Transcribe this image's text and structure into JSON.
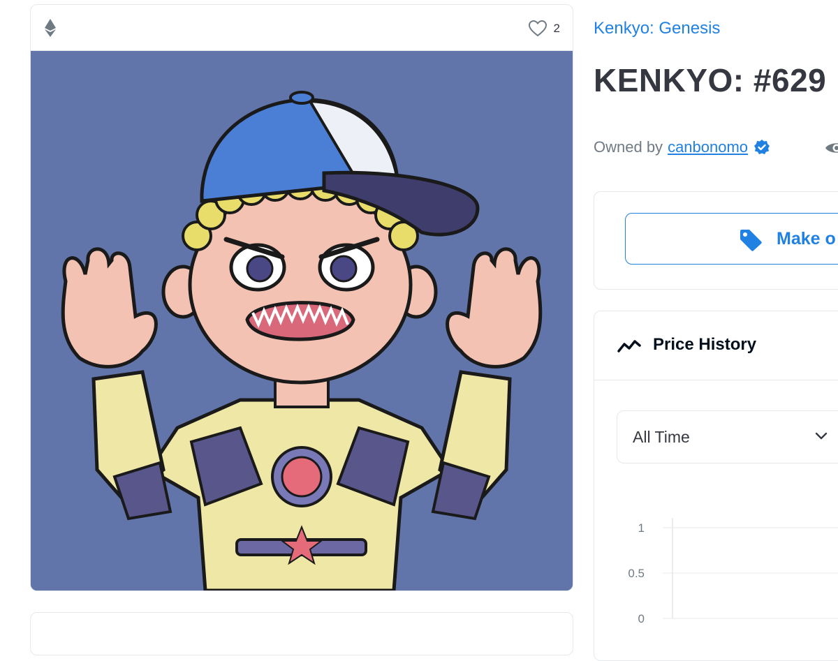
{
  "asset": {
    "favorites_count": "2",
    "image_alt": "Kenkyo cartoon character in a blue cap and yellow armor holding up both hands"
  },
  "collection": {
    "name": "Kenkyo: Genesis"
  },
  "item": {
    "title": "KENKYO: #629"
  },
  "owner": {
    "prefix": "Owned by",
    "name": "canbonomo",
    "verified": true
  },
  "actions": {
    "offer_label": "Make o"
  },
  "price_history": {
    "title": "Price History",
    "filter_value": "All Time"
  },
  "chart_data": {
    "type": "line",
    "title": "",
    "xlabel": "",
    "ylabel": "",
    "ylim": [
      0,
      1
    ],
    "yticks": [
      "1",
      "0.5",
      "0"
    ],
    "series": [],
    "grid": true
  },
  "colors": {
    "accent": "#2081e2",
    "text": "#353840",
    "muted": "#707a83",
    "border": "#e5e8eb",
    "art_background": "#6275ab"
  },
  "icons": {
    "chain": "ethereum-icon",
    "favorite": "heart-icon",
    "verified": "verified-badge-icon",
    "views": "eye-icon",
    "offer": "tag-icon",
    "price_history": "trend-line-icon",
    "dropdown": "chevron-down-icon"
  }
}
